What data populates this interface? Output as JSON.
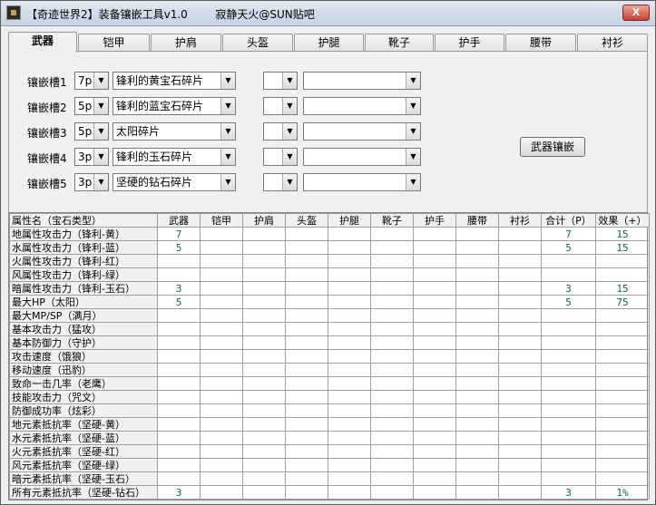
{
  "window": {
    "title": "【奇迹世界2】装备镶嵌工具v1.0        寂静天火@SUN贴吧",
    "close_label": "X"
  },
  "tabs": [
    "武器",
    "铠甲",
    "护肩",
    "头盔",
    "护腿",
    "靴子",
    "护手",
    "腰带",
    "衬衫"
  ],
  "active_tab": "武器",
  "slots": [
    {
      "label": "镶嵌槽1",
      "level": "7p",
      "gem": "锋利的黄宝石碎片",
      "extra_level": "",
      "extra_gem": ""
    },
    {
      "label": "镶嵌槽2",
      "level": "5p",
      "gem": "锋利的蓝宝石碎片",
      "extra_level": "",
      "extra_gem": ""
    },
    {
      "label": "镶嵌槽3",
      "level": "5p",
      "gem": "太阳碎片",
      "extra_level": "",
      "extra_gem": ""
    },
    {
      "label": "镶嵌槽4",
      "level": "3p",
      "gem": "锋利的玉石碎片",
      "extra_level": "",
      "extra_gem": ""
    },
    {
      "label": "镶嵌槽5",
      "level": "3p",
      "gem": "坚硬的钻石碎片",
      "extra_level": "",
      "extra_gem": ""
    }
  ],
  "inlay_button": "武器镶嵌",
  "table": {
    "headers": [
      "属性名（宝石类型）",
      "武器",
      "铠甲",
      "护肩",
      "头盔",
      "护腿",
      "靴子",
      "护手",
      "腰带",
      "衬衫",
      "合计（P）",
      "效果（+）"
    ],
    "rows": [
      [
        "地属性攻击力（锋利-黄）",
        "7",
        "",
        "",
        "",
        "",
        "",
        "",
        "",
        "",
        "7",
        "15"
      ],
      [
        "水属性攻击力（锋利-蓝）",
        "5",
        "",
        "",
        "",
        "",
        "",
        "",
        "",
        "",
        "5",
        "15"
      ],
      [
        "火属性攻击力（锋利-红）",
        "",
        "",
        "",
        "",
        "",
        "",
        "",
        "",
        "",
        "",
        ""
      ],
      [
        "风属性攻击力（锋利-绿）",
        "",
        "",
        "",
        "",
        "",
        "",
        "",
        "",
        "",
        "",
        ""
      ],
      [
        "暗属性攻击力（锋利-玉石）",
        "3",
        "",
        "",
        "",
        "",
        "",
        "",
        "",
        "",
        "3",
        "15"
      ],
      [
        "最大HP（太阳）",
        "5",
        "",
        "",
        "",
        "",
        "",
        "",
        "",
        "",
        "5",
        "75"
      ],
      [
        "最大MP/SP（满月）",
        "",
        "",
        "",
        "",
        "",
        "",
        "",
        "",
        "",
        "",
        ""
      ],
      [
        "基本攻击力（猛攻）",
        "",
        "",
        "",
        "",
        "",
        "",
        "",
        "",
        "",
        "",
        ""
      ],
      [
        "基本防御力（守护）",
        "",
        "",
        "",
        "",
        "",
        "",
        "",
        "",
        "",
        "",
        ""
      ],
      [
        "攻击速度（饿狼）",
        "",
        "",
        "",
        "",
        "",
        "",
        "",
        "",
        "",
        "",
        ""
      ],
      [
        "移动速度（迅豹）",
        "",
        "",
        "",
        "",
        "",
        "",
        "",
        "",
        "",
        "",
        ""
      ],
      [
        "致命一击几率（老鹰）",
        "",
        "",
        "",
        "",
        "",
        "",
        "",
        "",
        "",
        "",
        ""
      ],
      [
        "技能攻击力（咒文）",
        "",
        "",
        "",
        "",
        "",
        "",
        "",
        "",
        "",
        "",
        ""
      ],
      [
        "防御成功率（炫彩）",
        "",
        "",
        "",
        "",
        "",
        "",
        "",
        "",
        "",
        "",
        ""
      ],
      [
        "地元素抵抗率（坚硬-黄）",
        "",
        "",
        "",
        "",
        "",
        "",
        "",
        "",
        "",
        "",
        ""
      ],
      [
        "水元素抵抗率（坚硬-蓝）",
        "",
        "",
        "",
        "",
        "",
        "",
        "",
        "",
        "",
        "",
        ""
      ],
      [
        "火元素抵抗率（坚硬-红）",
        "",
        "",
        "",
        "",
        "",
        "",
        "",
        "",
        "",
        "",
        ""
      ],
      [
        "风元素抵抗率（坚硬-绿）",
        "",
        "",
        "",
        "",
        "",
        "",
        "",
        "",
        "",
        "",
        ""
      ],
      [
        "暗元素抵抗率（坚硬-玉石）",
        "",
        "",
        "",
        "",
        "",
        "",
        "",
        "",
        "",
        "",
        ""
      ],
      [
        "所有元素抵抗率（坚硬-钻石）",
        "3",
        "",
        "",
        "",
        "",
        "",
        "",
        "",
        "",
        "3",
        "1%"
      ]
    ]
  }
}
